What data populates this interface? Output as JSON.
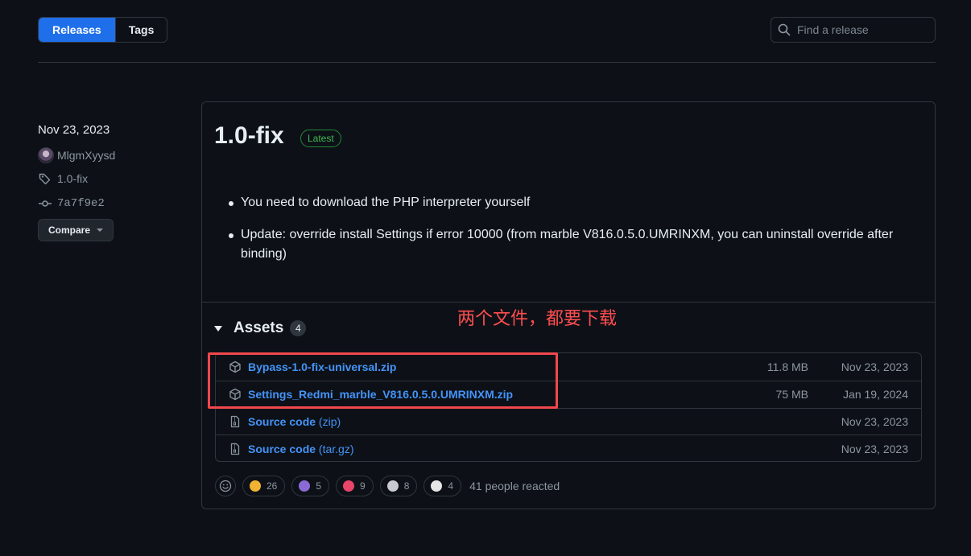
{
  "header": {
    "tabs": [
      {
        "label": "Releases",
        "active": true
      },
      {
        "label": "Tags",
        "active": false
      }
    ],
    "search": {
      "placeholder": "Find a release",
      "value": ""
    }
  },
  "sidebar": {
    "date": "Nov 23, 2023",
    "author": "MlgmXyysd",
    "tag": "1.0-fix",
    "commit": "7a7f9e2",
    "compare_label": "Compare"
  },
  "release": {
    "title": "1.0-fix",
    "badge": "Latest",
    "notes": [
      "You need to download the PHP interpreter yourself",
      "Update: override install Settings if error 10000 (from marble V816.0.5.0.UMRINXM, you can uninstall override after binding)"
    ],
    "assets_label": "Assets",
    "assets_count": "4",
    "annotation": "两个文件，都要下载",
    "assets": [
      {
        "name": "Bypass-1.0-fix-universal.zip",
        "suffix": "",
        "size": "11.8 MB",
        "date": "Nov 23, 2023",
        "icon": "package-icon"
      },
      {
        "name": "Settings_Redmi_marble_V816.0.5.0.UMRINXM.zip",
        "suffix": "",
        "size": "75 MB",
        "date": "Jan 19, 2024",
        "icon": "package-icon"
      },
      {
        "name": "Source code",
        "suffix": " (zip)",
        "size": "",
        "date": "Nov 23, 2023",
        "icon": "file-zip-icon"
      },
      {
        "name": "Source code",
        "suffix": " (tar.gz)",
        "size": "",
        "date": "Nov 23, 2023",
        "icon": "file-zip-icon"
      }
    ],
    "reactions": [
      {
        "icon": "thumbs-up-icon",
        "count": "26",
        "color": "#f2b233"
      },
      {
        "icon": "tada-icon",
        "count": "5",
        "color": "#8a6bd6"
      },
      {
        "icon": "heart-icon",
        "count": "9",
        "color": "#e8456b"
      },
      {
        "icon": "rocket-icon",
        "count": "8",
        "color": "#c9c9d1"
      },
      {
        "icon": "eyes-icon",
        "count": "4",
        "color": "#e6e6e6"
      }
    ],
    "reacted_text": "41 people reacted"
  }
}
